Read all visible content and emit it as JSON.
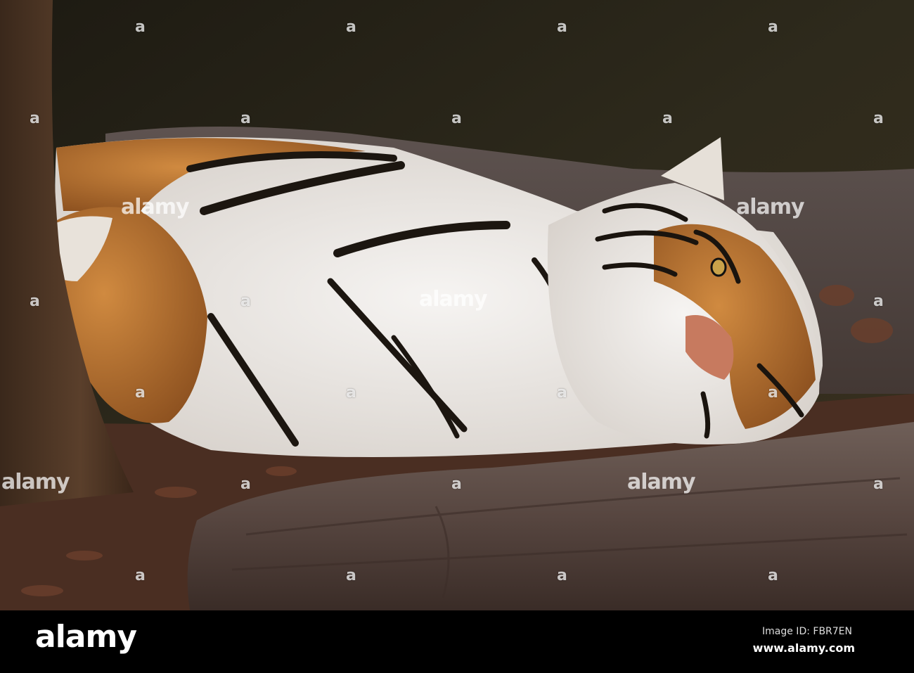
{
  "photo": {
    "subject": "tiger-lying-on-ground"
  },
  "watermark": {
    "glyph": "a",
    "text": "alamy"
  },
  "footer": {
    "logo": "alamy",
    "image_id": "Image ID: FBR7EN",
    "url": "www.alamy.com"
  },
  "colors": {
    "background": "#2b2619",
    "fur_orange": "#c0742f",
    "fur_white": "#eeeae6",
    "stripe": "#1c1610",
    "bark": "#4a3424"
  }
}
